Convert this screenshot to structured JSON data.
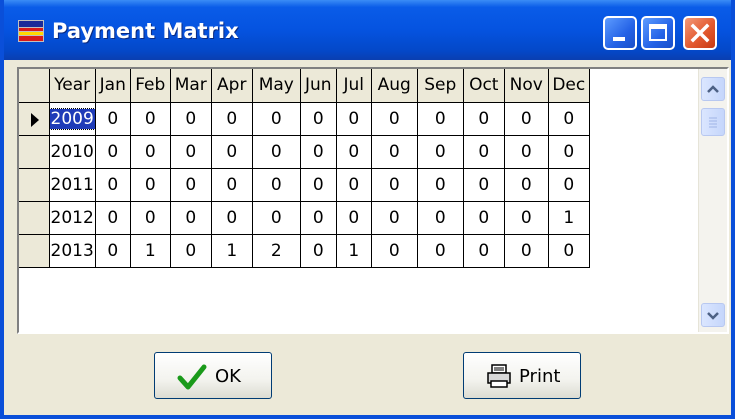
{
  "window": {
    "title": "Payment Matrix",
    "app_icon": "spreadsheet-app-icon"
  },
  "grid": {
    "headers": [
      "Year",
      "Jan",
      "Feb",
      "Mar",
      "Apr",
      "May",
      "Jun",
      "Jul",
      "Aug",
      "Sep",
      "Oct",
      "Nov",
      "Dec"
    ],
    "selected_row": 0,
    "rows": [
      [
        "2009",
        "0",
        "0",
        "0",
        "0",
        "0",
        "0",
        "0",
        "0",
        "0",
        "0",
        "0",
        "0"
      ],
      [
        "2010",
        "0",
        "0",
        "0",
        "0",
        "0",
        "0",
        "0",
        "0",
        "0",
        "0",
        "0",
        "0"
      ],
      [
        "2011",
        "0",
        "0",
        "0",
        "0",
        "0",
        "0",
        "0",
        "0",
        "0",
        "0",
        "0",
        "0"
      ],
      [
        "2012",
        "0",
        "0",
        "0",
        "0",
        "0",
        "0",
        "0",
        "0",
        "0",
        "0",
        "0",
        "1"
      ],
      [
        "2013",
        "0",
        "1",
        "0",
        "1",
        "2",
        "0",
        "1",
        "0",
        "0",
        "0",
        "0",
        "0"
      ]
    ]
  },
  "buttons": {
    "ok_label": "OK",
    "print_label": "Print"
  },
  "icons": {
    "ok": "checkmark-icon",
    "print": "printer-icon"
  },
  "colors": {
    "titlebar": "#0553e0",
    "selection": "#1f3cb8",
    "check": "#1a9a1a"
  }
}
